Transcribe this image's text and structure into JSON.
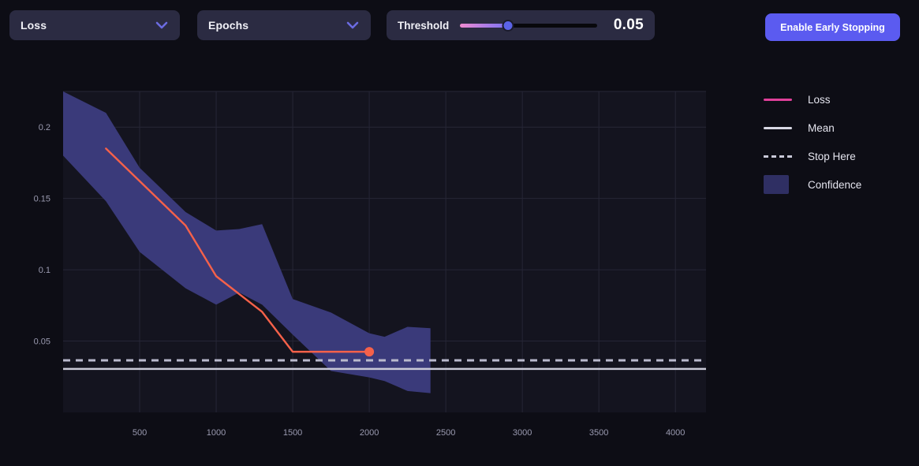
{
  "toolbar": {
    "metric_dropdown": {
      "value": "Loss",
      "icon": "chevron-down-icon"
    },
    "xaxis_dropdown": {
      "value": "Epochs",
      "icon": "chevron-down-icon"
    },
    "threshold": {
      "label": "Threshold",
      "value": "0.05",
      "slider_percent": 35
    },
    "early_stopping_button": "Enable Early Stopping"
  },
  "legend": {
    "items": [
      {
        "label": "Loss",
        "key": "line",
        "color": "#e0409a"
      },
      {
        "label": "Mean",
        "key": "line",
        "color": "#d8d8e4"
      },
      {
        "label": "Stop Here",
        "key": "dashed",
        "color": "#c9c9d8"
      },
      {
        "label": "Confidence",
        "key": "swatch",
        "color": "#2f2f63"
      }
    ]
  },
  "colors": {
    "page_background": "#0d0d15",
    "plot_background": "#14141f",
    "grid": "#262636",
    "loss_line": "#f5614a",
    "confidence_band": "#3a3a7a",
    "mean_line": "#c9c9d8",
    "stop_line": "#b9b9cc",
    "accent": "#5b5bf0"
  },
  "chart_data": {
    "type": "line",
    "title": "",
    "xlabel": "Epochs",
    "ylabel": "Loss",
    "xlim": [
      0,
      4200
    ],
    "ylim": [
      0,
      0.225
    ],
    "grid": true,
    "legend_position": "right",
    "x_ticks": [
      500,
      1000,
      1500,
      2000,
      2500,
      3000,
      3500,
      4000
    ],
    "y_ticks": [
      0.05,
      0.1,
      0.15,
      0.2
    ],
    "series": [
      {
        "name": "Loss",
        "color": "#f5614a",
        "x": [
          280,
          800,
          1000,
          1300,
          1500,
          2000
        ],
        "values": [
          0.185,
          0.131,
          0.0955,
          0.0705,
          0.0425,
          0.0425
        ],
        "end_marker": {
          "x": 2000,
          "y": 0.0425
        }
      },
      {
        "name": "Mean",
        "color": "#c9c9d8",
        "type": "hline",
        "value": 0.0305
      },
      {
        "name": "Stop Here",
        "color": "#b9b9cc",
        "type": "hline-dashed",
        "value": 0.0365
      }
    ],
    "confidence_band": {
      "name": "Confidence",
      "color": "#3a3a7a",
      "x": [
        0,
        280,
        500,
        800,
        1000,
        1150,
        1300,
        1500,
        1750,
        2000,
        2100,
        2250,
        2400
      ],
      "upper": [
        0.225,
        0.21,
        0.1715,
        0.1405,
        0.1275,
        0.1285,
        0.132,
        0.0795,
        0.07,
        0.0555,
        0.053,
        0.06,
        0.059
      ],
      "lower": [
        0.18,
        0.148,
        0.1125,
        0.087,
        0.0755,
        0.084,
        0.0755,
        0.0545,
        0.029,
        0.0245,
        0.022,
        0.015,
        0.0135
      ]
    }
  }
}
